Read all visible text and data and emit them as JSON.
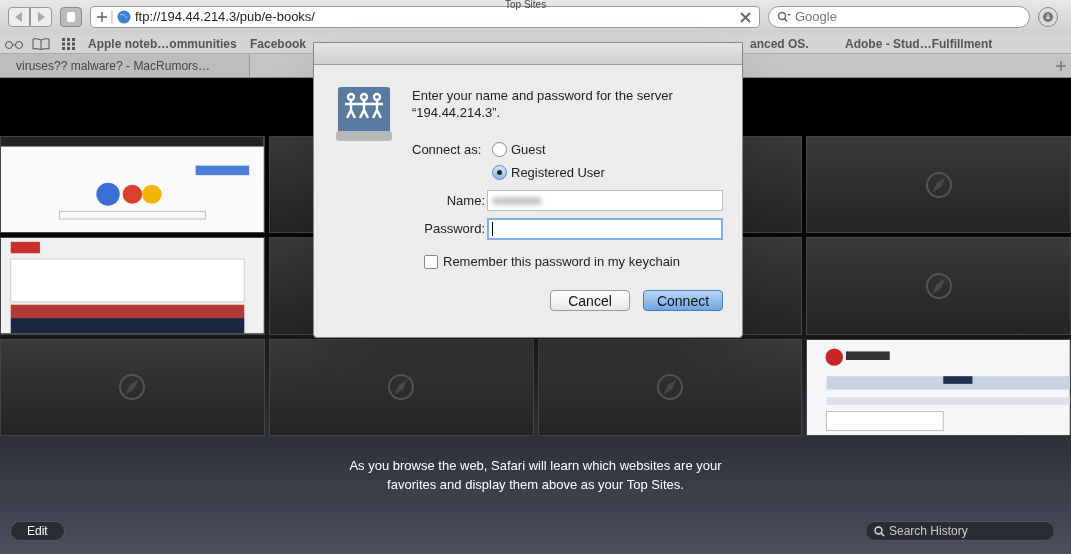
{
  "window": {
    "title": "Top Sites"
  },
  "toolbar": {
    "url": "ftp://194.44.214.3/pub/e-books/",
    "search": {
      "placeholder": "Google"
    }
  },
  "bookmarks": [
    "Apple noteb…ommunities",
    "Facebook",
    "anced OS.",
    "Adobe - Stud…Fulfillment"
  ],
  "tabs": [
    {
      "label": "viruses?? malware? - MacRumors…",
      "selected": false
    }
  ],
  "top_sites": [
    {
      "kind": "picture"
    },
    {
      "kind": "covered"
    },
    {
      "kind": "covered"
    },
    {
      "kind": "empty"
    },
    {
      "kind": "picture"
    },
    {
      "kind": "covered"
    },
    {
      "kind": "covered"
    },
    {
      "kind": "empty"
    },
    {
      "kind": "empty"
    },
    {
      "kind": "empty"
    },
    {
      "kind": "empty"
    },
    {
      "kind": "picture"
    }
  ],
  "info": "As you browse the web, Safari will learn which websites are your favorites and display them above as your Top Sites.",
  "bottom": {
    "edit": "Edit",
    "search_placeholder": "Search History"
  },
  "dialog": {
    "message": "Enter your name and password for the server “194.44.214.3”.",
    "connect_as_label": "Connect as:",
    "options": [
      {
        "label": "Guest",
        "selected": false
      },
      {
        "label": "Registered User",
        "selected": true
      }
    ],
    "name_label": "Name:",
    "password_label": "Password:",
    "remember": {
      "label": "Remember this password in my keychain",
      "checked": false
    },
    "buttons": [
      {
        "label": "Cancel",
        "kind": "secondary"
      },
      {
        "label": "Connect",
        "kind": "default"
      }
    ]
  }
}
